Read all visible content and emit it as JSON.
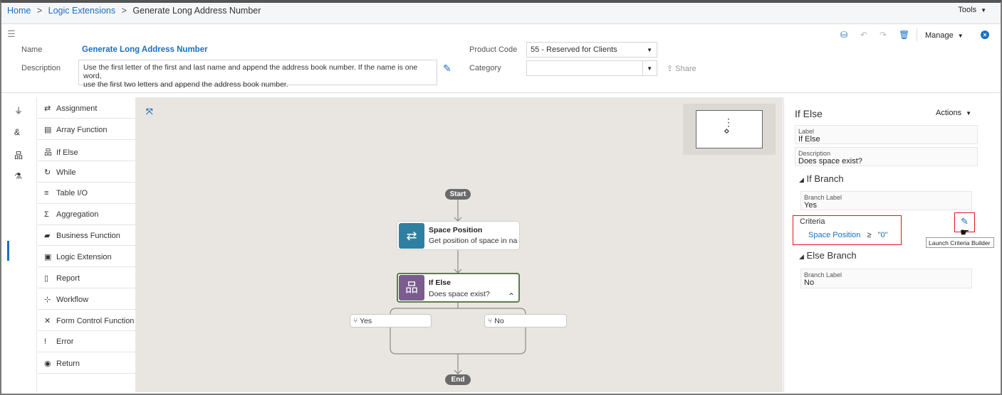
{
  "breadcrumb": {
    "home": "Home",
    "sep": ">",
    "logic_extensions": "Logic Extensions",
    "current": "Generate Long Address Number"
  },
  "tools_menu": "Tools",
  "form": {
    "name_label": "Name",
    "name_value": "Generate Long Address Number",
    "description_label": "Description",
    "description_line1": "Use the first letter of the first and last name and append the address book number.  If the name is one word,",
    "description_line2": "use the first two letters and append the address book number.",
    "product_code_label": "Product Code",
    "product_code_value": "55 - Reserved for Clients",
    "category_label": "Category",
    "category_value": "",
    "share_label": "Share"
  },
  "toolbar": {
    "manage_label": "Manage"
  },
  "palette": [
    {
      "label": "Assignment",
      "icon": "assignment-icon",
      "glyph": "⇄"
    },
    {
      "label": "Array Function",
      "icon": "array-function-icon",
      "glyph": "▤"
    },
    {
      "label": "If Else",
      "icon": "if-else-icon",
      "glyph": "品"
    },
    {
      "label": "While",
      "icon": "while-icon",
      "glyph": "↻"
    },
    {
      "label": "Table I/O",
      "icon": "table-io-icon",
      "glyph": "≡"
    },
    {
      "label": "Aggregation",
      "icon": "sigma-icon",
      "glyph": "Σ"
    },
    {
      "label": "Business Function",
      "icon": "briefcase-icon",
      "glyph": "▰"
    },
    {
      "label": "Logic Extension",
      "icon": "logic-extension-icon",
      "glyph": "▣"
    },
    {
      "label": "Report",
      "icon": "report-icon",
      "glyph": "▯"
    },
    {
      "label": "Workflow",
      "icon": "workflow-icon",
      "glyph": "⊹"
    },
    {
      "label": "Form Control Function",
      "icon": "tools-icon",
      "glyph": "✕"
    },
    {
      "label": "Error",
      "icon": "exclamation-icon",
      "glyph": "!"
    },
    {
      "label": "Return",
      "icon": "return-icon",
      "glyph": "◉"
    }
  ],
  "flow": {
    "start": "Start",
    "end": "End",
    "node1": {
      "title": "Space Position",
      "subtitle": "Get position of space in na",
      "color": "#2e7fa0"
    },
    "node2": {
      "title": "If Else",
      "subtitle": "Does space exist?",
      "color": "#7a5c8e"
    },
    "branch_yes": "Yes",
    "branch_no": "No",
    "selected_border": "#5e7d4a"
  },
  "properties": {
    "title": "If Else",
    "actions_label": "Actions",
    "label_label": "Label",
    "label_value": "If Else",
    "description_label": "Description",
    "description_value": "Does space exist?",
    "if_branch": {
      "heading": "If Branch",
      "branch_label_label": "Branch Label",
      "branch_label_value": "Yes",
      "criteria_label": "Criteria",
      "criteria_field": "Space Position",
      "criteria_operator": "≥",
      "criteria_value": "\"0\""
    },
    "else_branch": {
      "heading": "Else Branch",
      "branch_label_label": "Branch Label",
      "branch_label_value": "No"
    },
    "tooltip": "Launch Criteria Builder"
  },
  "colors": {
    "link": "#1a6fbf",
    "highlight": "#e0141e",
    "canvas": "#e9e6e2"
  }
}
